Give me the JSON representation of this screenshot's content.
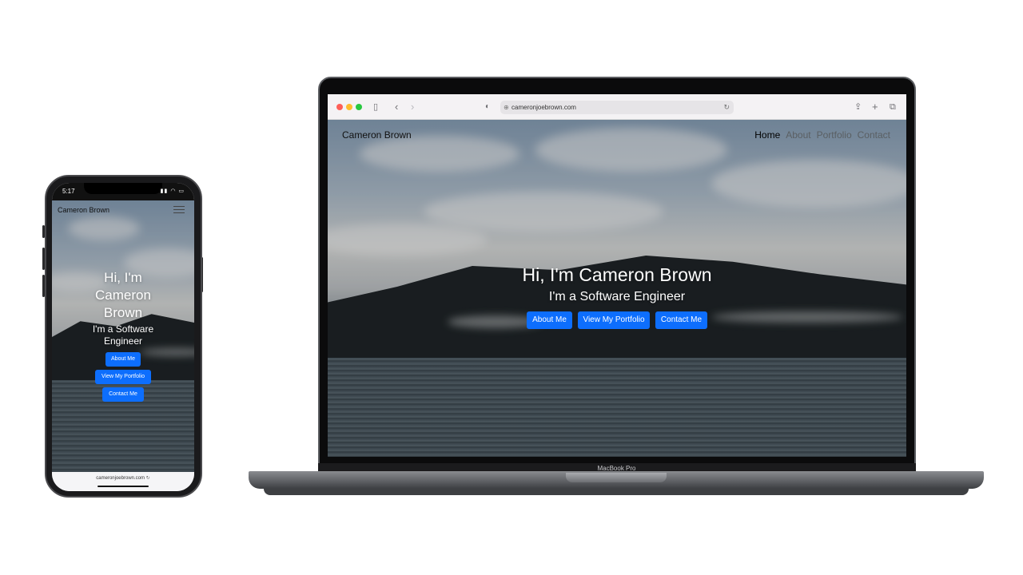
{
  "mac": {
    "browser": {
      "url": "cameronjoebrown.com"
    },
    "site": {
      "brand": "Cameron Brown",
      "nav": [
        {
          "label": "Home",
          "active": true
        },
        {
          "label": "About",
          "active": false
        },
        {
          "label": "Portfolio",
          "active": false
        },
        {
          "label": "Contact",
          "active": false
        }
      ],
      "hero_title": "Hi, I'm Cameron Brown",
      "hero_subtitle": "I'm a Software Engineer",
      "buttons": {
        "about": "About Me",
        "portfolio": "View My Portfolio",
        "contact": "Contact Me"
      }
    },
    "device_label": "MacBook Pro"
  },
  "phone": {
    "status": {
      "time": "5:17"
    },
    "site": {
      "brand": "Cameron Brown",
      "hero_title": "Hi, I'm Cameron Brown",
      "hero_subtitle": "I'm a Software Engineer",
      "buttons": {
        "about": "About Me",
        "portfolio": "View My Portfolio",
        "contact": "Contact Me"
      }
    },
    "url": "cameronjoebrown.com"
  },
  "colors": {
    "button_blue": "#0d6efd",
    "nav_inactive": "#5a5f63",
    "nav_active": "#000000"
  }
}
